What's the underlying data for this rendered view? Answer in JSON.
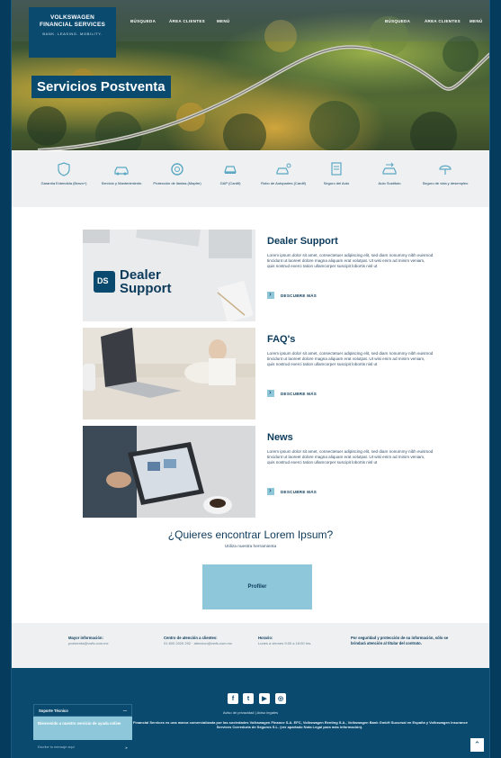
{
  "header": {
    "logo": {
      "line1": "VOLKSWAGEN",
      "line2": "FINANCIAL SERVICES",
      "tagline": "BANK. LEASING. MOBILITY."
    },
    "nav_left": [
      "BÚSQUEDA",
      "ÁREA CLIENTES",
      "MENÚ"
    ],
    "nav_right": [
      "BÚSQUEDA",
      "ÁREA CLIENTES",
      "MENÚ"
    ],
    "hero_title": "Servicios Postventa"
  },
  "services": [
    {
      "icon": "shield-icon",
      "label": "Garantía Extendida (Bravo+)"
    },
    {
      "icon": "car-wrench-icon",
      "label": "Servicio y Mantenimiento"
    },
    {
      "icon": "tire-icon",
      "label": "Protección de llantas (Mapfre)"
    },
    {
      "icon": "car-icon",
      "label": "GAP (Cardif)"
    },
    {
      "icon": "car-keys-icon",
      "label": "Robo de Autopartes (Cardif)"
    },
    {
      "icon": "document-car-icon",
      "label": "Seguro del Auto"
    },
    {
      "icon": "car-swap-icon",
      "label": "Auto Sustituto"
    },
    {
      "icon": "umbrella-person-icon",
      "label": "Seguro de vida y desempleo"
    }
  ],
  "cards": [
    {
      "title": "Dealer Support",
      "image": "dealer-support-image",
      "logo_mark": "DS",
      "logo_line1": "Dealer",
      "logo_line2": "Support",
      "text": "Lorem ipsum dolor sit amet, consectetuer adipiscing elit, sed diam nonummy nibh euismod tincidunt ut laoreet dolore magna aliquam erat volutpat. Ut wisi enim ad minim veniam, quis nostrud exerci tation ullamcorper suscipit lobortis nisl ut",
      "link": "DESCUBRE MÁS"
    },
    {
      "title": "FAQ's",
      "image": "laptop-typing-image",
      "text": "Lorem ipsum dolor sit amet, consectetuer adipiscing elit, sed diam nonummy nibh euismod tincidunt ut laoreet dolore magna aliquam erat volutpat. Ut wisi enim ad minim veniam, quis nostrud exerci tation ullamcorper suscipit lobortis nisl ut",
      "link": "DESCUBRE MÁS"
    },
    {
      "title": "News",
      "image": "tablet-news-image",
      "text": "Lorem ipsum dolor sit amet, consectetuer adipiscing elit, sed diam nonummy nibh euismod tincidunt ut laoreet dolore magna aliquam erat volutpat. Ut wisi enim ad minim veniam, quis nostrud exerci tation ullamcorper suscipit lobortis nisl ut",
      "link": "DESCUBRE MÁS"
    }
  ],
  "cta": {
    "title": "¿Quieres encontrar Lorem Ipsum?",
    "subtitle": "Utiliza nuestra herramienta",
    "button": "Profiler"
  },
  "info": [
    {
      "heading": "Mayor información:",
      "text": "postventa@vwfs.com.mx"
    },
    {
      "heading": "Centro de atención a clientes:",
      "text": "01 800 2020 292 · atencion@vwfs.com.mx"
    },
    {
      "heading": "Horario:",
      "text": "Lunes a viernes 9:00 a 18:00 hrs."
    },
    {
      "heading": "Por seguridad y protección de su información, sólo se brindará atención al titular del contrato.",
      "text": ""
    }
  ],
  "footer": {
    "social": [
      {
        "icon": "facebook-icon",
        "glyph": "f"
      },
      {
        "icon": "twitter-icon",
        "glyph": "t"
      },
      {
        "icon": "youtube-icon",
        "glyph": "▶"
      },
      {
        "icon": "instagram-icon",
        "glyph": "◎"
      }
    ],
    "links": "Aviso de privacidad | Aviso legales",
    "legal": "Volkswagen Financial Services es una marca comercializada por las sociedades Volkswagen Finance S.A. EFC, Volkswagen Renting S.A., Volkswagen Bank GmbH Sucursal en España y Volkswagen Insurance Services Correduría de Seguros S.L. (ver apartado Nota Legal para más información)."
  },
  "widget": {
    "title": "Soporte Técnico",
    "toggle": "—",
    "body": "Bienvenido a nuestro servicio de ayuda online",
    "input_placeholder": "Escribe tu mensaje aquí",
    "send_glyph": "➤"
  },
  "colors": {
    "brand": "#0b4a6f",
    "accent": "#8ec7d9",
    "page_bg": "#053c5e",
    "strip": "#eef0f1"
  }
}
